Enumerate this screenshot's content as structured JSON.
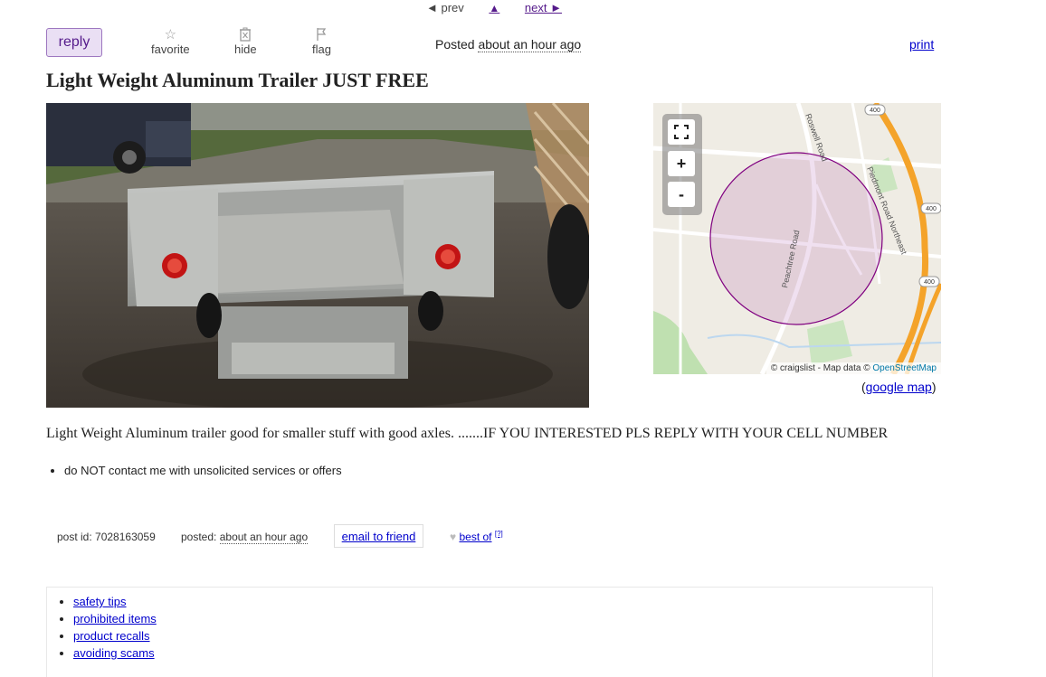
{
  "nav": {
    "prev": "◄ prev",
    "up": "▲",
    "next": "next ►"
  },
  "actions": {
    "reply": "reply",
    "favorite": "favorite",
    "hide": "hide",
    "flag": "flag",
    "posted_label": "Posted",
    "posted_time": "about an hour ago",
    "print": "print"
  },
  "title": "Light Weight Aluminum Trailer JUST FREE",
  "map": {
    "attribution_prefix": "© craigslist - Map data © ",
    "attribution_osm": "OpenStreetMap",
    "road_labels": [
      "Roswell Road",
      "Piedmont Road Northeast",
      "Peachtree Road"
    ],
    "shields": [
      "400",
      "400",
      "400"
    ],
    "zoom_in": "+",
    "zoom_out": "-",
    "google_map": "google map",
    "circle_color": "#800080"
  },
  "description": "Light Weight Aluminum trailer good for smaller stuff with good axles. .......IF YOU INTERESTED PLS REPLY WITH YOUR CELL NUMBER",
  "notices": [
    "do NOT contact me with unsolicited services or offers"
  ],
  "postinfo": {
    "post_id": "post id: 7028163059",
    "posted_label": "posted:",
    "posted_time": "about an hour ago",
    "email": "email to friend",
    "best_of": "best of",
    "best_of_sup": "[?]"
  },
  "footer_links": [
    "safety tips",
    "prohibited items",
    "product recalls",
    "avoiding scams"
  ],
  "colors": {
    "link": "#0000cc",
    "visited": "#551a8b",
    "reply_bg": "#eadff4"
  }
}
